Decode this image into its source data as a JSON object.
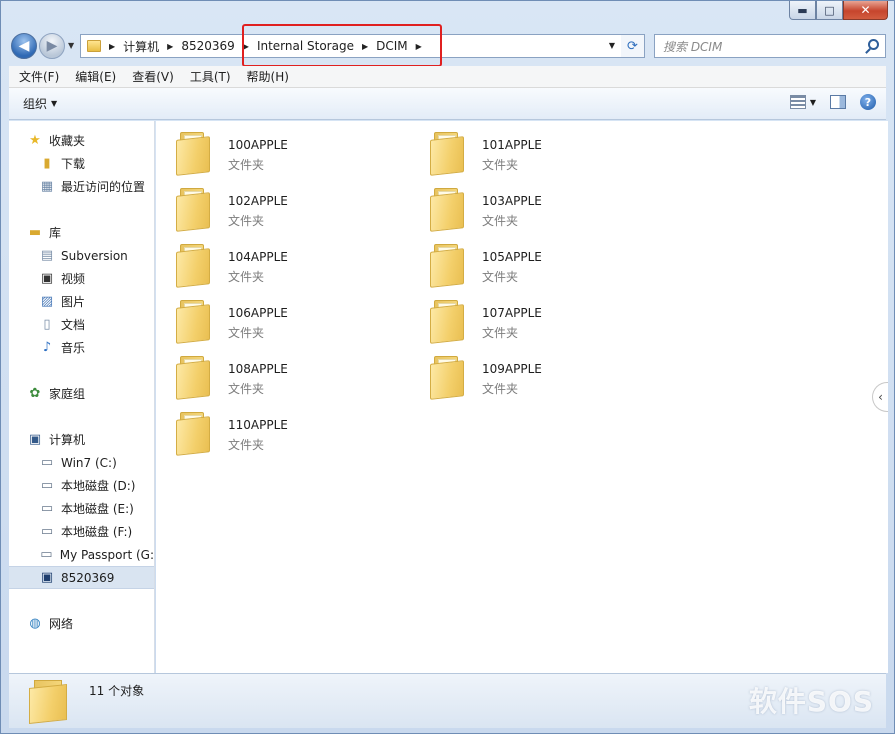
{
  "window": {
    "minimize": "▬",
    "maximize": "□",
    "close": "✕"
  },
  "address": {
    "crumbs": [
      "计算机",
      "8520369",
      "Internal Storage",
      "DCIM"
    ],
    "search_placeholder": "搜索 DCIM"
  },
  "menu": [
    "文件(F)",
    "编辑(E)",
    "查看(V)",
    "工具(T)",
    "帮助(H)"
  ],
  "toolbar": {
    "organize": "组织"
  },
  "nav": {
    "favorites": "收藏夹",
    "downloads": "下载",
    "recent": "最近访问的位置",
    "libraries": "库",
    "subversion": "Subversion",
    "videos": "视频",
    "pictures": "图片",
    "documents": "文档",
    "music": "音乐",
    "homegroup": "家庭组",
    "computer": "计算机",
    "drive_c": "Win7 (C:)",
    "drive_d": "本地磁盘 (D:)",
    "drive_e": "本地磁盘 (E:)",
    "drive_f": "本地磁盘 (F:)",
    "drive_g": "My Passport (G:",
    "device": "8520369",
    "network": "网络"
  },
  "folders": [
    {
      "name": "100APPLE",
      "type": "文件夹"
    },
    {
      "name": "101APPLE",
      "type": "文件夹"
    },
    {
      "name": "102APPLE",
      "type": "文件夹"
    },
    {
      "name": "103APPLE",
      "type": "文件夹"
    },
    {
      "name": "104APPLE",
      "type": "文件夹"
    },
    {
      "name": "105APPLE",
      "type": "文件夹"
    },
    {
      "name": "106APPLE",
      "type": "文件夹"
    },
    {
      "name": "107APPLE",
      "type": "文件夹"
    },
    {
      "name": "108APPLE",
      "type": "文件夹"
    },
    {
      "name": "109APPLE",
      "type": "文件夹"
    },
    {
      "name": "110APPLE",
      "type": "文件夹"
    }
  ],
  "status": {
    "count": "11 个对象"
  },
  "watermark": "软件SOS",
  "colors": {
    "highlight": "#e02020",
    "folder": "#f3cf6a"
  }
}
